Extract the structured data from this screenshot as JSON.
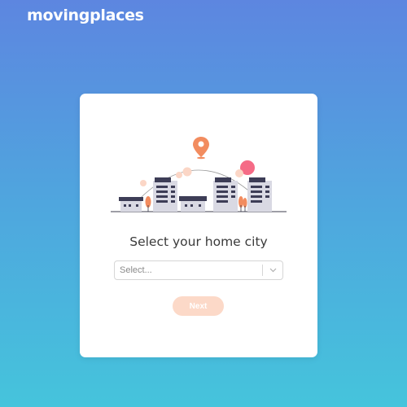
{
  "brand": {
    "logo_text": "movingplaces"
  },
  "card": {
    "heading": "Select your home city",
    "select": {
      "placeholder": "Select..."
    },
    "next_label": "Next"
  },
  "colors": {
    "accent": "#f28c5f",
    "button_disabled": "#fcd9c8",
    "background_top": "#5d86e0",
    "background_bottom": "#45c4dc"
  },
  "icons": [
    "location-pin-icon",
    "chevron-down-icon"
  ]
}
